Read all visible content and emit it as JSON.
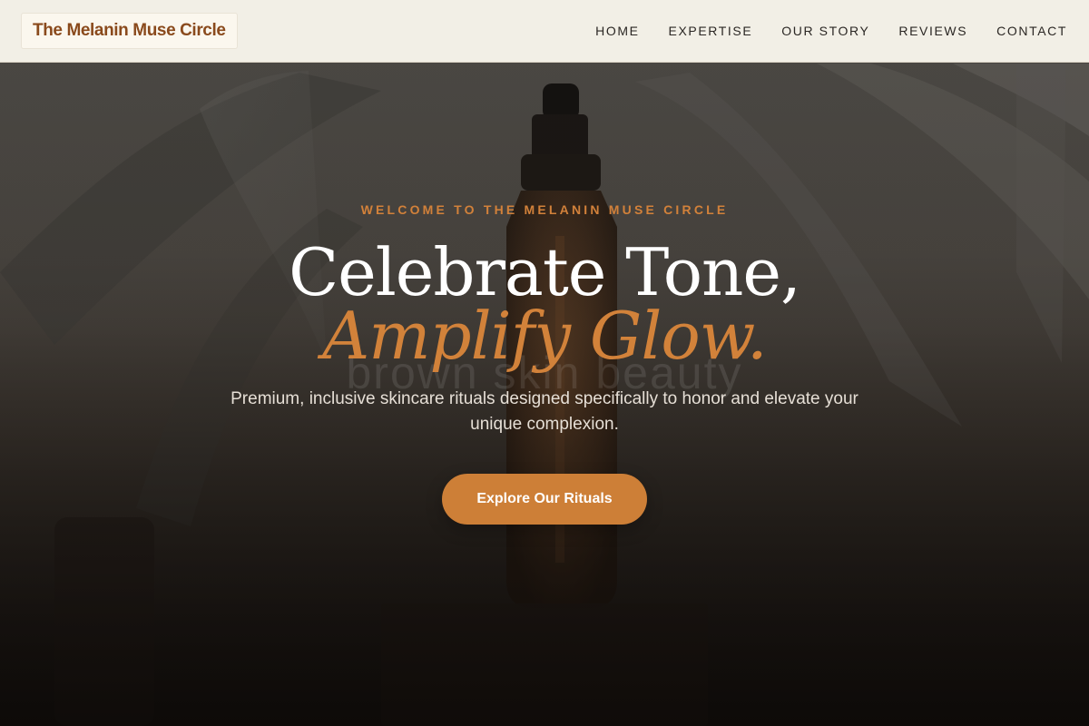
{
  "nav": {
    "logo": "The Melanin Muse Circle",
    "links": [
      "HOME",
      "EXPERTISE",
      "OUR STORY",
      "REVIEWS",
      "CONTACT"
    ]
  },
  "hero": {
    "eyebrow": "WELCOME TO THE MELANIN MUSE CIRCLE",
    "headline_line1": "Celebrate Tone,",
    "headline_line2": "Amplify Glow.",
    "watermark": "brown skin beauty",
    "subtitle": "Premium, inclusive skincare rituals designed specifically to honor and elevate your unique complexion.",
    "cta_label": "Explore Our Rituals"
  },
  "colors": {
    "accent": "#cd7f37",
    "logo_text": "#8a4a1c",
    "nav_background": "#f2efe6"
  }
}
